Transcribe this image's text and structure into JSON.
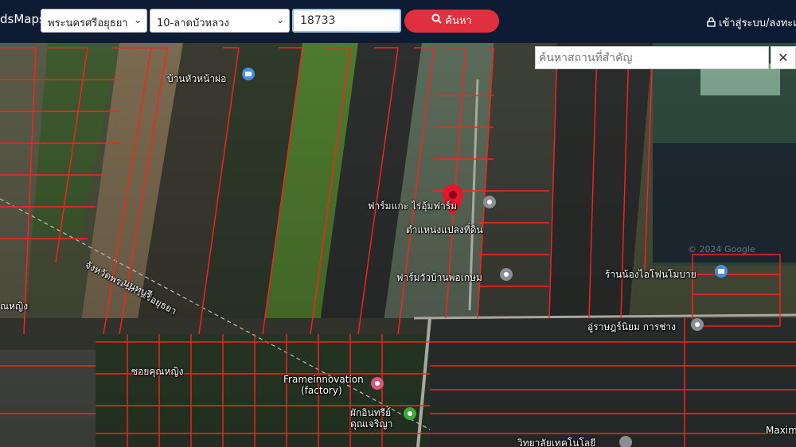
{
  "header": {
    "brand": "dsMaps",
    "province_select": "พระนครศรีอยุธยา",
    "district_select": "10-ลาดบัวหลวง",
    "parcel_input": "18733",
    "search_label": "ค้นหา",
    "login_label": "เข้าสู่ระบบ/ลงทะเ"
  },
  "map": {
    "place_search_placeholder": "ค้นหาสถานที่สำคัญ",
    "close_symbol": "✕",
    "watermark": "© 2024 Google",
    "labels": {
      "baan_hua_na": "บ้านหัวหน้าผ่อ",
      "farm_kae": "ฟาร์มแกะ ไร่อุ้มฟาร์ม",
      "parcel_position": "ตำแหน่งแปลงที่ดิน",
      "farm_cow": "ฟาร์มวัวบ้านพ่อเกษม",
      "shop_phone": "ร้านน้องไอโฟนโมบาย",
      "garage": "อู่ราษฎร์นิยม การช่าง",
      "province_line": "จังหวัดพระนครศรีอยุธยา",
      "province_line2": "นนทบุรี",
      "soi": "ซอยคุณหญิง",
      "nhing": "ณหญิง",
      "frame": "Frameinnovation",
      "frame2": "(factory)",
      "organic": "ผักอินทรีย์",
      "organic2": "ดุณเจริญา",
      "college": "วิทยาลัยเทคโนโลยี",
      "maxim": "Maxim"
    },
    "icons": [
      "map-pin",
      "poi-pin",
      "shopping-pin"
    ]
  }
}
